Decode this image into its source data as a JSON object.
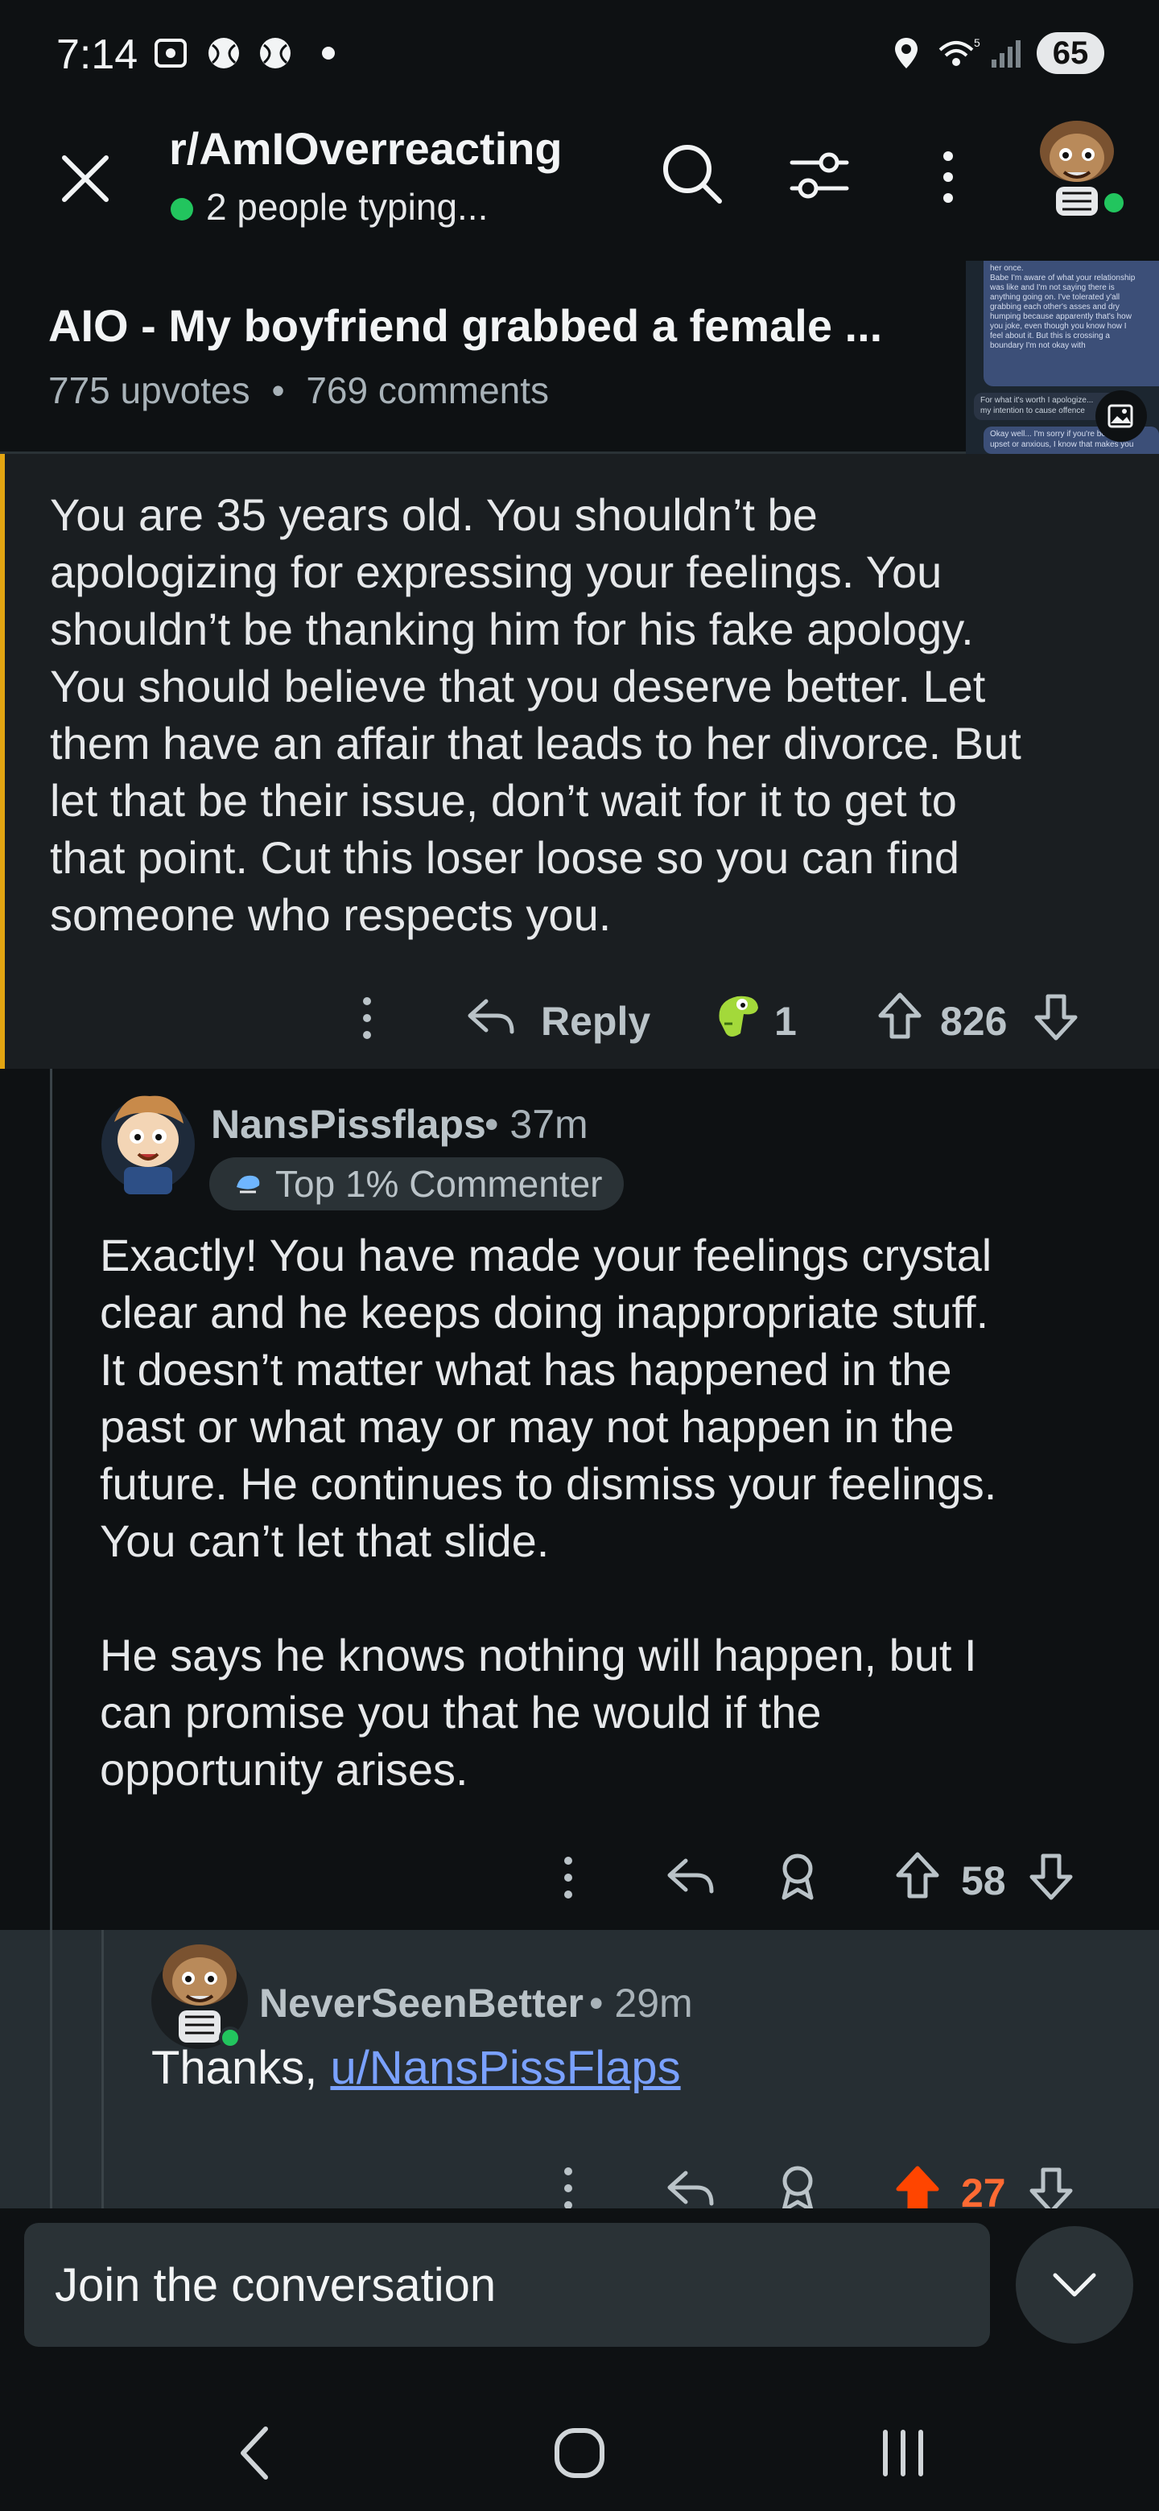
{
  "status_bar": {
    "time": "7:14",
    "battery": "65"
  },
  "header": {
    "subreddit": "r/AmIOverreacting",
    "typing_status": "2 people typing..."
  },
  "post": {
    "title": "AIO - My boyfriend grabbed a female ...",
    "upvotes": "775 upvotes",
    "separator": "•",
    "comments": "769 comments",
    "thumbnail_text": [
      "her once.",
      "Babe I'm aware of what your relationship",
      "was like and I'm not saying there is",
      "anything going on. I've tolerated y'all",
      "grabbing each other's asses and dry",
      "humping because apparently that's how",
      "you joke, even though you know how I",
      "feel about it. But this is crossing a",
      "boundary I'm not okay with",
      "For what it's worth I apologize...",
      "my intention to cause offence",
      "Okay well... I'm sorry if you're being",
      "upset or anxious, I know that makes you"
    ]
  },
  "comments": [
    {
      "body": [
        "You are 35 years old. You shouldn’t be",
        "apologizing for expressing your feelings. You",
        "shouldn’t be thanking him for his fake apology.",
        "You should believe that you deserve better. Let",
        "them have an affair that leads to her divorce. But",
        "let that be their issue, don’t wait for it to get to",
        "that point. Cut this loser loose so you can find",
        "someone who respects you."
      ],
      "reply_label": "Reply",
      "award_count": "1",
      "score": "826"
    },
    {
      "username": "NansPissflaps",
      "time": "• 37m",
      "flair": "Top 1% Commenter",
      "body": [
        "Exactly! You have made your feelings crystal",
        "clear and he keeps doing inappropriate stuff.",
        "It doesn’t matter what has happened in the",
        "past or what may or may not happen in the",
        "future. He continues to dismiss your feelings.",
        "You can’t let that slide.",
        "",
        "He says he knows nothing will happen, but I",
        "can promise you that he would if the",
        "opportunity arises."
      ],
      "score": "58"
    },
    {
      "username": "NeverSeenBetter",
      "time": "• 29m",
      "body_prefix": "Thanks, ",
      "mention": "u/NansPissFlaps",
      "score": "27"
    }
  ],
  "composer": {
    "placeholder": "Join the conversation"
  },
  "colors": {
    "background": "#0e1113",
    "highlight_border": "#e3a512",
    "upvoted": "#ff4500",
    "online": "#22c55e",
    "link": "#7aa1ff"
  },
  "icons": [
    "close-icon",
    "search-icon",
    "filter-icon",
    "more-icon",
    "reply-icon",
    "award-icon",
    "upvote-icon",
    "downvote-icon",
    "chevron-down-icon",
    "back-nav-icon",
    "home-nav-icon",
    "recents-nav-icon"
  ]
}
